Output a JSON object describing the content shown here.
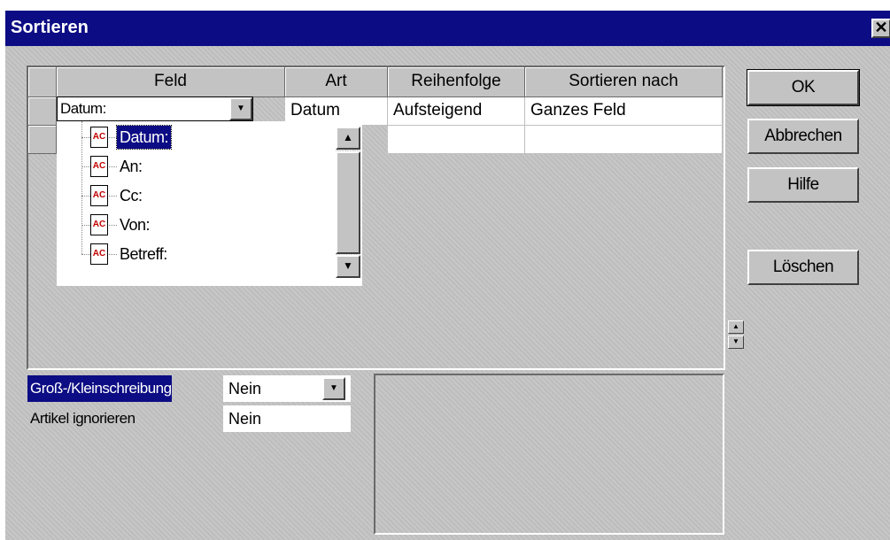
{
  "window": {
    "title": "Sortieren",
    "close_glyph": "✕"
  },
  "grid": {
    "columns": [
      "Feld",
      "Art",
      "Reihenfolge",
      "Sortieren nach"
    ],
    "rows": [
      {
        "feld": "Datum:",
        "art": "Datum",
        "reihenfolge": "Aufsteigend",
        "sortieren_nach": "Ganzes Feld"
      },
      {
        "feld": "",
        "art": "",
        "reihenfolge": "",
        "sortieren_nach": ""
      }
    ]
  },
  "field_dropdown": {
    "selected": "Datum:",
    "items": [
      "Datum:",
      "An:",
      "Cc:",
      "Von:",
      "Betreff:"
    ],
    "item_icon": "text-field-icon"
  },
  "buttons": {
    "ok": "OK",
    "cancel": "Abbrechen",
    "help": "Hilfe",
    "delete": "Löschen"
  },
  "properties": [
    {
      "label": "Groß-/Kleinschreibung",
      "value": "Nein",
      "selected": true
    },
    {
      "label": "Artikel ignorieren",
      "value": "Nein",
      "selected": false
    }
  ],
  "colors": {
    "titlebar": "#0c0c84",
    "face": "#c3c3c3",
    "selection": "#0c0c84"
  }
}
